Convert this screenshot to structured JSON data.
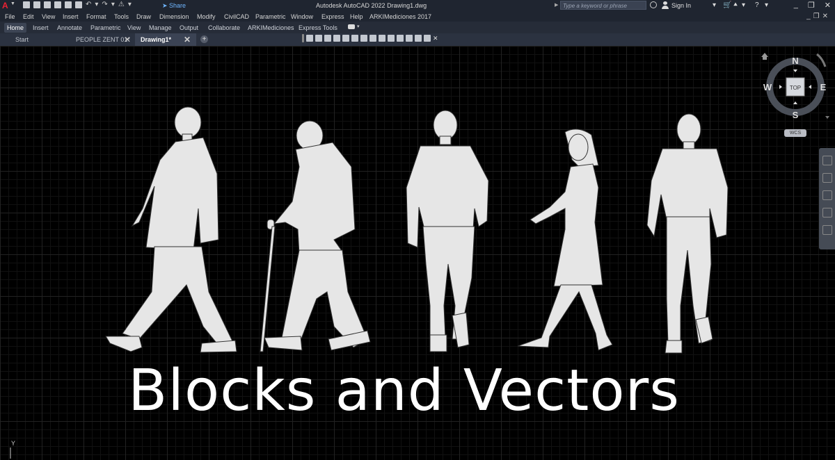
{
  "app": {
    "title": "Autodesk AutoCAD 2022    Drawing1.dwg",
    "logo": "A",
    "share_label": "Share",
    "search_placeholder": "Type a keyword or phrase",
    "sign_in_label": "Sign In"
  },
  "menu": {
    "items": [
      "File",
      "Edit",
      "View",
      "Insert",
      "Format",
      "Tools",
      "Draw",
      "Dimension",
      "Modify",
      "CivilCAD",
      "Parametric",
      "Window",
      "Express",
      "Help",
      "ARKIMediciones 2017"
    ]
  },
  "ribbon": {
    "tabs": [
      "Home",
      "Insert",
      "Annotate",
      "Parametric",
      "View",
      "Manage",
      "Output",
      "Collaborate",
      "ARKIMediciones",
      "Express Tools"
    ],
    "active_tab": "Home"
  },
  "file_tabs": {
    "tabs": [
      "Start",
      "PEOPLE ZENT 01*",
      "Drawing1*"
    ],
    "active_tab": "Drawing1*"
  },
  "canvas": {
    "headline": "Blocks and Vectors"
  },
  "viewcube": {
    "north": "N",
    "south": "S",
    "east": "E",
    "west": "W",
    "face": "TOP",
    "wcs_label": "WCS"
  },
  "ucs": {
    "y_label": "Y"
  },
  "colors": {
    "titlebar": "#1f2530",
    "canvas": "#000000",
    "figure_fill": "#e6e6e6",
    "accent_blue": "#6fb6ff",
    "logo_red": "#e22a33"
  }
}
